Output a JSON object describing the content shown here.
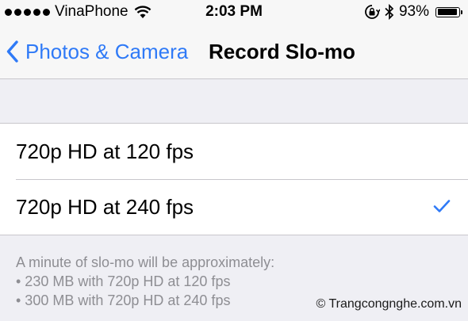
{
  "status_bar": {
    "carrier": "VinaPhone",
    "time": "2:03 PM",
    "battery_percent": "93%",
    "battery_level": 0.93,
    "icons": [
      "signal-dots-icon",
      "wifi-icon",
      "orientation-lock-icon",
      "bluetooth-icon",
      "battery-icon"
    ]
  },
  "nav": {
    "back_label": "Photos & Camera",
    "title": "Record Slo-mo"
  },
  "options": [
    {
      "label": "720p HD at 120 fps",
      "selected": false
    },
    {
      "label": "720p HD at 240 fps",
      "selected": true
    }
  ],
  "footer": {
    "intro": "A minute of slo-mo will be approximately:",
    "lines": [
      "• 230 MB with 720p HD at 120 fps",
      "• 300 MB with 720p HD at 240 fps"
    ]
  },
  "watermark": "© Trangcongnghe.com.vn",
  "colors": {
    "accent": "#2f7af7",
    "background": "#efeff4",
    "footer_text": "#8e8e93"
  }
}
